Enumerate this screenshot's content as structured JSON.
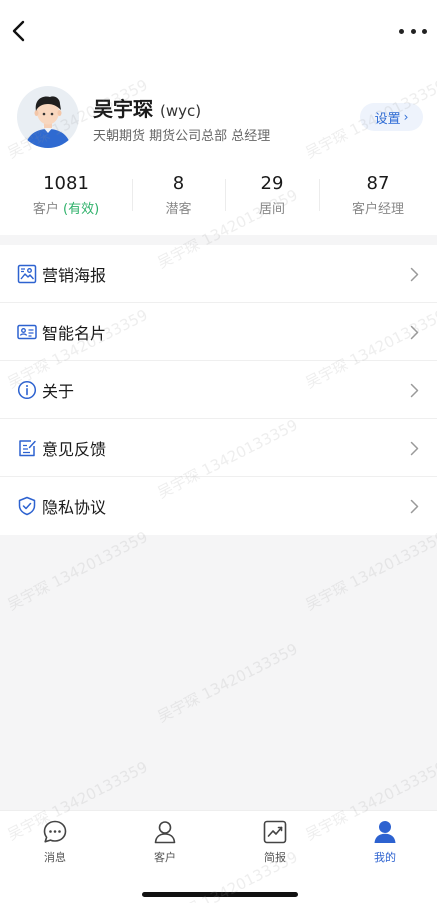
{
  "header": {
    "back_icon": "chevron-left-icon",
    "more_icon": "more-dots-icon"
  },
  "profile": {
    "name": "吴宇琛",
    "nickname": "(wyc)",
    "subtitle": "天朝期货 期货公司总部 总经理",
    "settings_label": "设置",
    "settings_chevron": "›"
  },
  "stats": [
    {
      "value": "1081",
      "label": "客户",
      "label_suffix": "(有效)"
    },
    {
      "value": "8",
      "label": "潜客"
    },
    {
      "value": "29",
      "label": "居间"
    },
    {
      "value": "87",
      "label": "客户经理"
    }
  ],
  "menu": [
    {
      "label": "营销海报",
      "icon": "poster-icon"
    },
    {
      "label": "智能名片",
      "icon": "business-card-icon"
    },
    {
      "label": "关于",
      "icon": "info-icon"
    },
    {
      "label": "意见反馈",
      "icon": "feedback-edit-icon"
    },
    {
      "label": "隐私协议",
      "icon": "shield-check-icon"
    }
  ],
  "tabbar": [
    {
      "label": "消息",
      "icon": "chat-bubble-icon",
      "active": false
    },
    {
      "label": "客户",
      "icon": "person-outline-icon",
      "active": false
    },
    {
      "label": "简报",
      "icon": "chart-trend-icon",
      "active": false
    },
    {
      "label": "我的",
      "icon": "person-filled-icon",
      "active": true
    }
  ],
  "watermark": "吴宇琛 13420133359",
  "colors": {
    "accent": "#2d62d0",
    "green": "#2eb16a",
    "background": "#f5f5f6"
  }
}
